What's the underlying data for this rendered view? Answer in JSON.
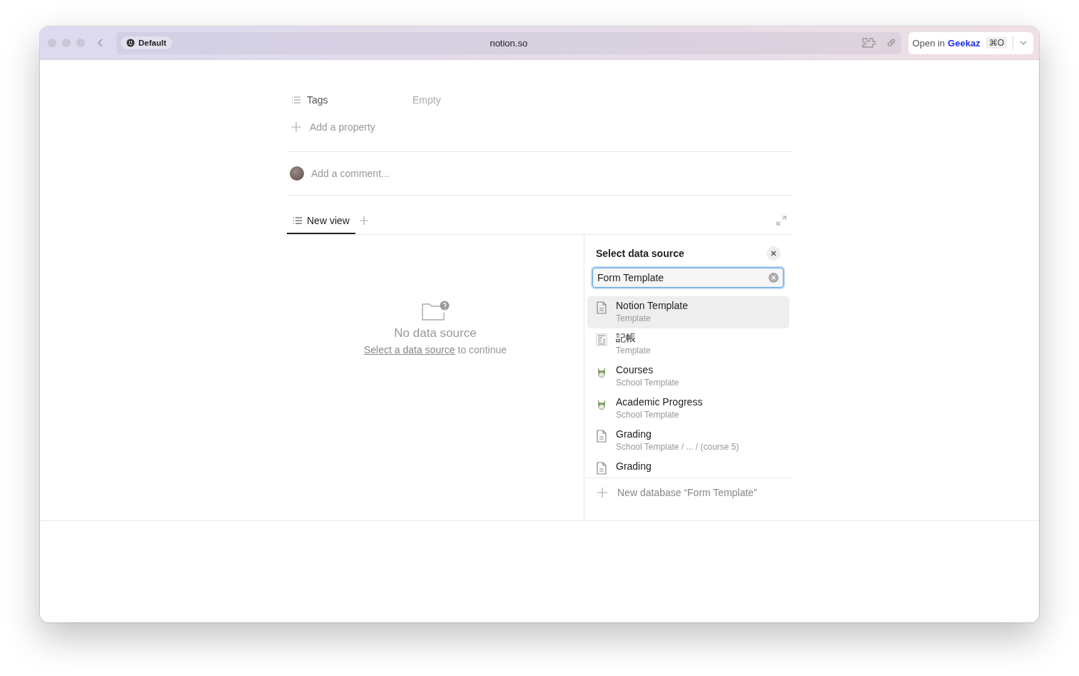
{
  "browser": {
    "profile": "Default",
    "address": "notion.so",
    "open_in": {
      "prefix": "Open in",
      "app": "Geekaz",
      "shortcut": "⌘O"
    }
  },
  "properties": [
    {
      "kind": "list",
      "label": "Tags",
      "value": "Empty"
    },
    {
      "kind": "add",
      "label": "Add a property"
    }
  ],
  "comment": {
    "placeholder": "Add a comment..."
  },
  "views": [
    {
      "label": "New view",
      "selected": true
    }
  ],
  "empty_state": {
    "title": "No data source",
    "link": "Select a data source",
    "rest": "to continue"
  },
  "picker": {
    "title": "Select data source",
    "search": "Form Template",
    "results": [
      {
        "kind": "page",
        "name": "Notion Template",
        "path": "Template",
        "selected": true
      },
      {
        "kind": "receipt",
        "name": "記帳",
        "path": "Template",
        "selected": false
      },
      {
        "kind": "creature",
        "name": "Courses",
        "path": "School Template",
        "selected": false
      },
      {
        "kind": "creature",
        "name": "Academic Progress",
        "path": "School Template",
        "selected": false
      },
      {
        "kind": "page",
        "name": "Grading",
        "path": "School Template / ... / (course 5)",
        "selected": false
      },
      {
        "kind": "page",
        "name": "Grading",
        "selected": false
      }
    ],
    "create": "New database “Form Template”"
  }
}
